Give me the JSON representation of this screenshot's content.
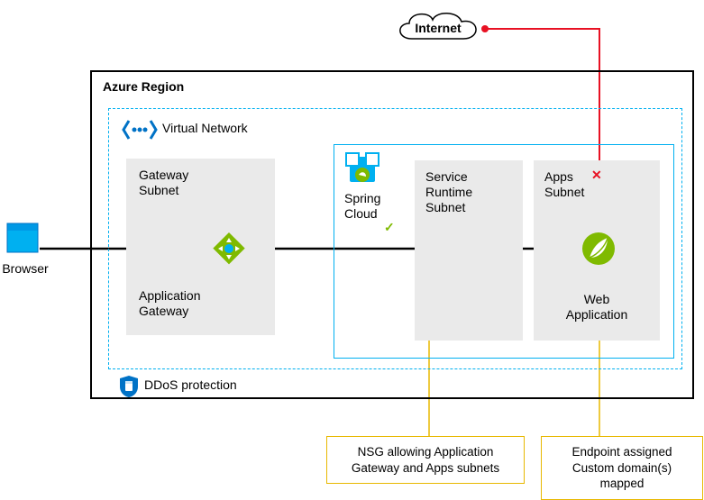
{
  "internet": {
    "label": "Internet"
  },
  "region": {
    "title": "Azure Region"
  },
  "vnet": {
    "label": "Virtual Network"
  },
  "gatewaySubnet": {
    "title1": "Gateway",
    "title2": "Subnet",
    "appGw1": "Application",
    "appGw2": "Gateway"
  },
  "springCloud": {
    "label1": "Spring",
    "label2": "Cloud"
  },
  "serviceRuntime": {
    "line1": "Service",
    "line2": "Runtime",
    "line3": "Subnet"
  },
  "appsSubnet": {
    "line1": "Apps",
    "line2": "Subnet",
    "webApp1": "Web",
    "webApp2": "Application"
  },
  "browser": {
    "label": "Browser"
  },
  "ddos": {
    "label": "DDoS protection"
  },
  "callouts": {
    "nsg": {
      "line1": "NSG allowing Application",
      "line2": "Gateway and Apps subnets"
    },
    "endpoint": {
      "line1": "Endpoint assigned",
      "line2": "Custom domain(s) mapped"
    }
  },
  "checkmark": "✓",
  "redX": "✕",
  "colors": {
    "azureBlue": "#0072c6",
    "cyanBorder": "#00b0f0",
    "green": "#7fba00",
    "red": "#e81123",
    "yellow": "#e8b800",
    "grey": "#eaeaea"
  }
}
